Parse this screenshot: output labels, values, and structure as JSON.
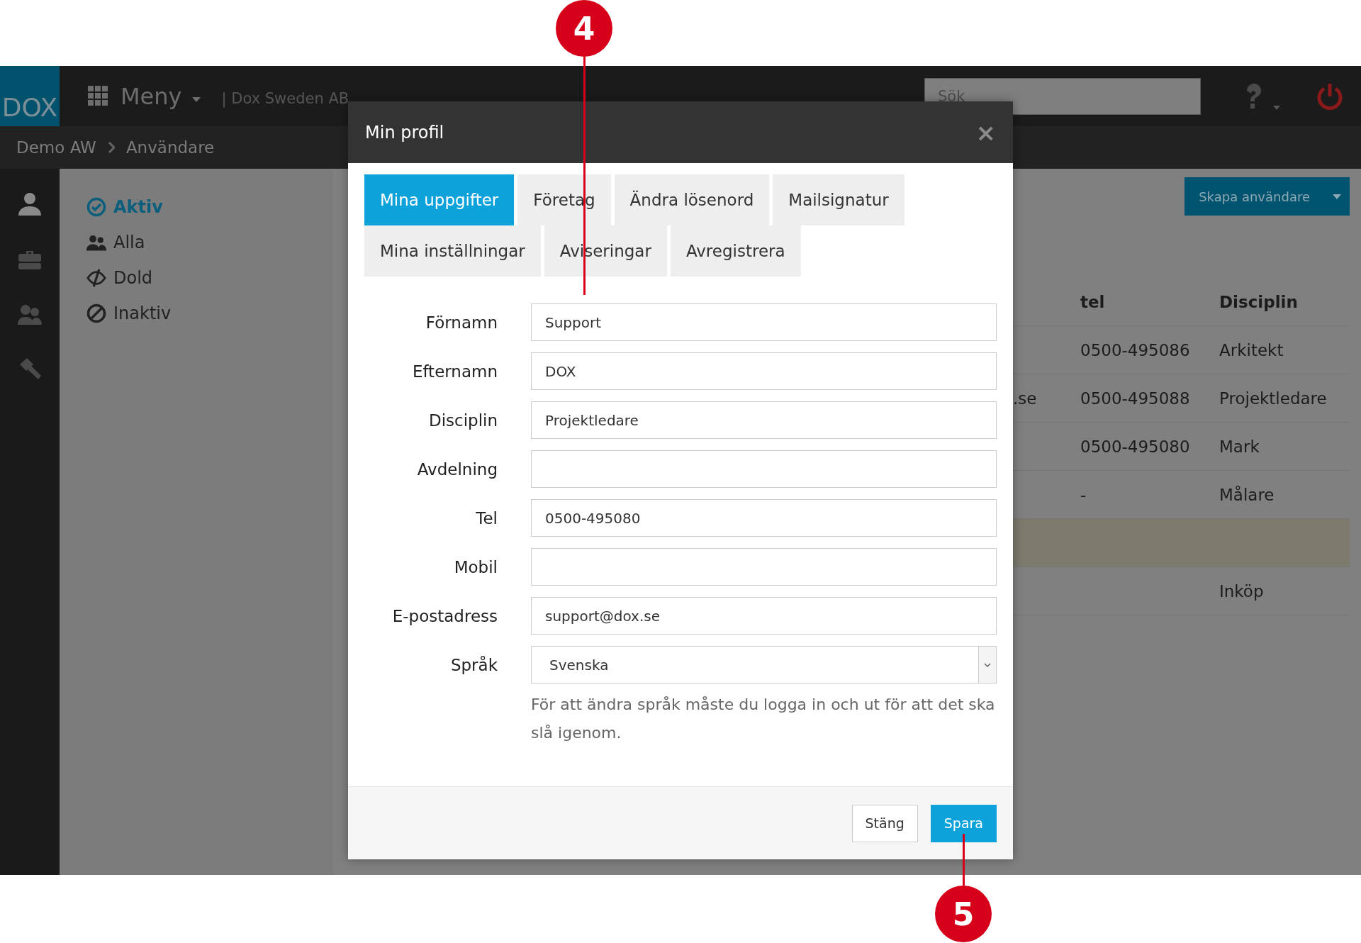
{
  "top_bar": {
    "logo": "DOX",
    "menu": "Meny",
    "company": "| Dox Sweden AB",
    "search": {
      "placeholder": "Sök"
    }
  },
  "breadcrumbs": [
    "Demo AW",
    "Användare"
  ],
  "filters": [
    {
      "label": "Aktiv",
      "kind": "check",
      "selected": true
    },
    {
      "label": "Alla",
      "kind": "group",
      "selected": false
    },
    {
      "label": "Dold",
      "kind": "hidden",
      "selected": false
    },
    {
      "label": "Inaktiv",
      "kind": "blocked",
      "selected": false
    }
  ],
  "create_button": "Skapa användare",
  "table": {
    "columns": [
      "tel",
      "Disciplin"
    ],
    "rows": [
      {
        "tel": "0500-495086",
        "disciplin": "Arkitekt",
        "highlighted": false
      },
      {
        "column_1": ".se",
        "tel": "0500-495088",
        "disciplin": "Projektledare",
        "highlighted": false
      },
      {
        "tel": "0500-495080",
        "disciplin": "Mark",
        "highlighted": false
      },
      {
        "tel": "-",
        "disciplin": "Målare",
        "highlighted": false
      },
      {
        "highlighted": true
      },
      {
        "disciplin": "Inköp",
        "highlighted": false
      }
    ]
  },
  "modal": {
    "title": "Min profil",
    "close": "×",
    "tabs": [
      {
        "label": "Mina uppgifter",
        "selected": true
      },
      {
        "label": "Företag",
        "selected": false
      },
      {
        "label": "Ändra lösenord",
        "selected": false
      },
      {
        "label": "Mailsignatur",
        "selected": false
      },
      {
        "label": "Mina inställningar",
        "selected": false
      },
      {
        "label": "Aviseringar",
        "selected": false
      },
      {
        "label": "Avregistrera",
        "selected": false
      }
    ],
    "fields": [
      {
        "label": "Förnamn",
        "value": "Support",
        "kind": "text"
      },
      {
        "label": "Efternamn",
        "value": "DOX",
        "kind": "text"
      },
      {
        "label": "Disciplin",
        "value": "Projektledare",
        "kind": "text"
      },
      {
        "label": "Avdelning",
        "kind": "text"
      },
      {
        "label": "Tel",
        "value": "0500-495080",
        "kind": "text"
      },
      {
        "label": "Mobil",
        "kind": "text"
      },
      {
        "label": "E-postadress",
        "value": "support@dox.se",
        "kind": "text"
      },
      {
        "label": "Språk",
        "value": "Svenska",
        "kind": "select"
      }
    ],
    "hint": "För att ändra språk måste du logga in och ut för att det ska slå igenom.",
    "buttons": [
      {
        "label": "Stäng",
        "kind": "default"
      },
      {
        "label": "Spara",
        "kind": "primary"
      }
    ]
  },
  "callouts": [
    {
      "number": "4"
    },
    {
      "number": "5"
    }
  ]
}
